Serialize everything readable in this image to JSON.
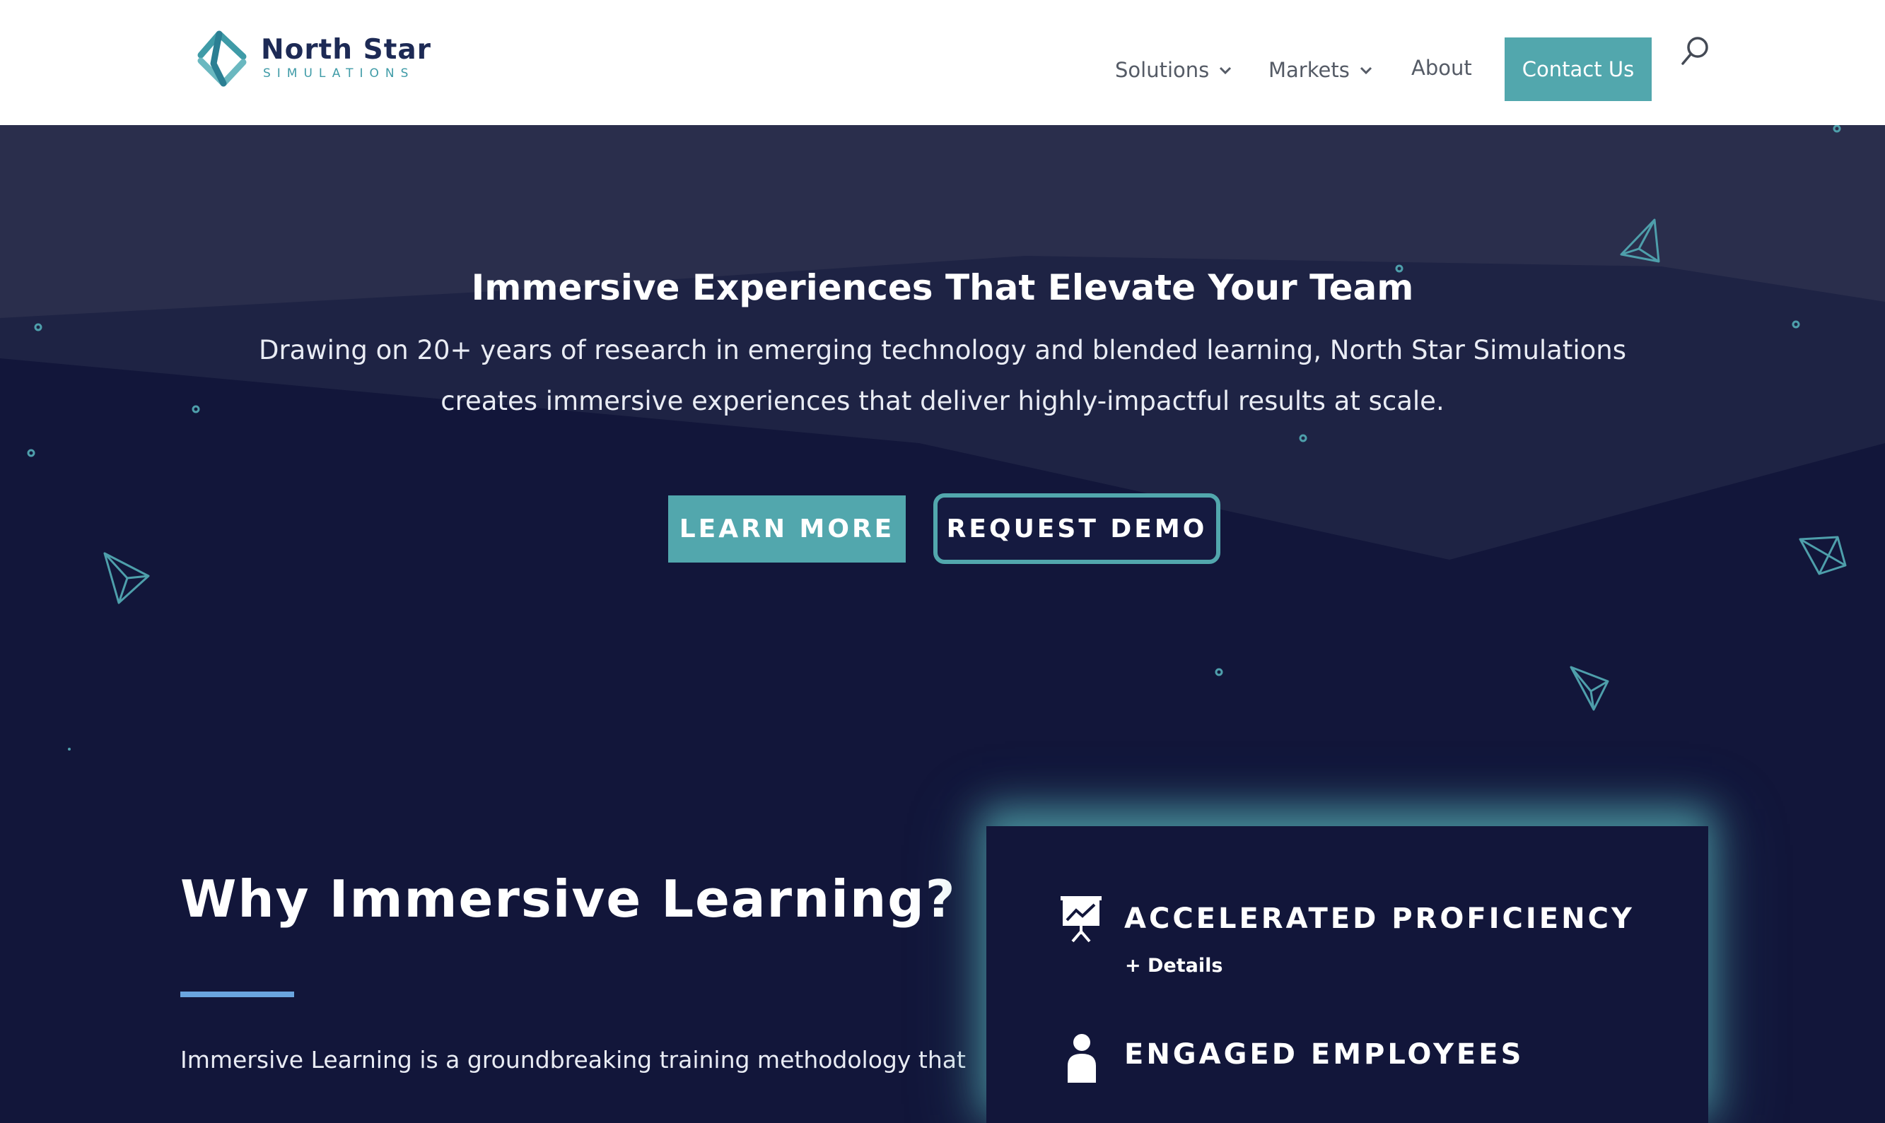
{
  "header": {
    "logo": {
      "name": "North Star",
      "subtitle": "SIMULATIONS"
    },
    "nav": [
      {
        "label": "Solutions",
        "has_dropdown": true
      },
      {
        "label": "Markets",
        "has_dropdown": true
      },
      {
        "label": "About",
        "has_dropdown": false
      }
    ],
    "contact_label": "Contact Us",
    "search_icon": "search-icon"
  },
  "hero": {
    "title": "Immersive Experiences That Elevate Your Team",
    "description": "Drawing on 20+ years of research in emerging technology and blended learning, North Star Simulations creates immersive experiences that deliver highly-impactful results at scale.",
    "learn_more_label": "LEARN MORE",
    "request_demo_label": "REQUEST DEMO"
  },
  "why": {
    "title": "Why Immersive Learning?",
    "body": "Immersive Learning is a groundbreaking training methodology that"
  },
  "features": [
    {
      "icon": "presentation-chart-icon",
      "title": "ACCELERATED PROFICIENCY",
      "details_label": "+ Details"
    },
    {
      "icon": "person-icon",
      "title": "ENGAGED EMPLOYEES"
    }
  ],
  "colors": {
    "accent": "#52a7ad",
    "navy": "#12163a",
    "hero_top": "#2a2e4c",
    "header_bg": "#ffffff",
    "divider": "#6aa5df"
  }
}
